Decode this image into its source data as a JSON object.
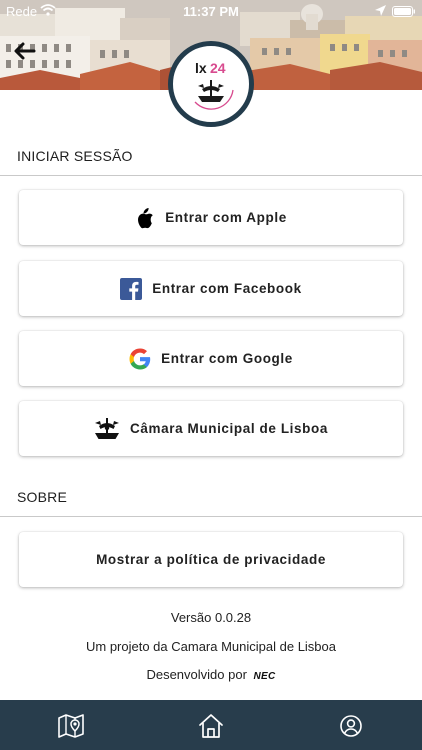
{
  "status_bar": {
    "carrier": "Rede",
    "time": "11:37 PM",
    "icons": [
      "wifi-icon",
      "location-arrow-icon",
      "battery-icon"
    ]
  },
  "header": {
    "back_icon": "arrow-left-icon",
    "logo_text": "lx24",
    "colors": {
      "badge_ring": "#233c4c",
      "logo_accent": "#d84b8f"
    }
  },
  "login_section": {
    "title": "INICIAR SESSÃO",
    "buttons": [
      {
        "label": "Entrar com Apple",
        "icon": "apple-icon"
      },
      {
        "label": "Entrar com Facebook",
        "icon": "facebook-icon"
      },
      {
        "label": "Entrar com Google",
        "icon": "google-icon"
      },
      {
        "label": "Câmara Municipal de Lisboa",
        "icon": "lisbon-emblem-icon"
      }
    ]
  },
  "about_section": {
    "title": "SOBRE",
    "privacy_button": "Mostrar a política de privacidade",
    "version": "Versão 0.0.28",
    "project": "Um projeto da Camara Municipal de Lisboa",
    "developed_by": "Desenvolvido por",
    "developer_logo": "NEC"
  },
  "tab_bar": {
    "tabs": [
      {
        "name": "map-icon"
      },
      {
        "name": "home-icon"
      },
      {
        "name": "profile-icon"
      }
    ],
    "color": "#283d4c"
  }
}
